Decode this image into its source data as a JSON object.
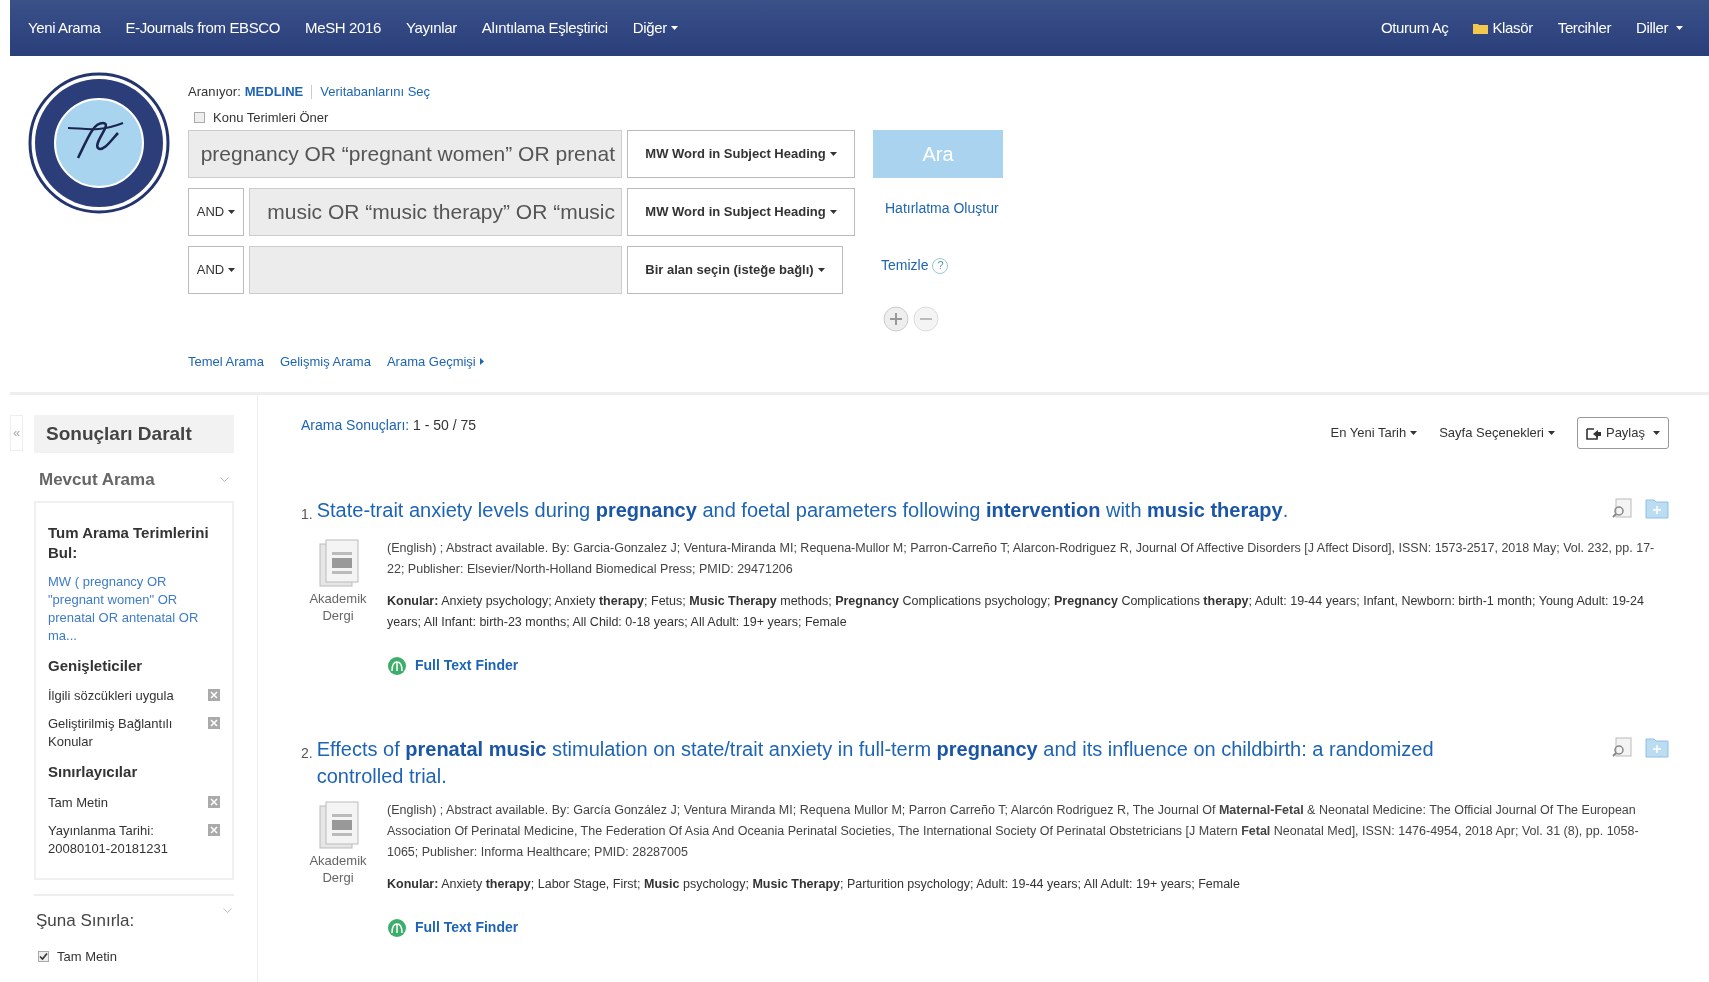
{
  "nav": {
    "left": [
      {
        "label": "Yeni Arama",
        "dropdown": false
      },
      {
        "label": "E-Journals from EBSCO",
        "dropdown": false
      },
      {
        "label": "MeSH 2016",
        "dropdown": false
      },
      {
        "label": "Yayınlar",
        "dropdown": false
      },
      {
        "label": "Alıntılama Eşleştirici",
        "dropdown": false
      },
      {
        "label": "Diğer",
        "dropdown": true
      }
    ],
    "right": [
      {
        "label": "Oturum Aç",
        "kind": "link",
        "dropdown": false
      },
      {
        "label": "Klasör",
        "kind": "folder",
        "dropdown": false
      },
      {
        "label": "Tercihler",
        "kind": "link",
        "dropdown": false
      },
      {
        "label": "Diller",
        "kind": "link",
        "dropdown": true
      }
    ]
  },
  "search": {
    "searching_label": "Aranıyor:",
    "database": "MEDLINE",
    "choose_db": "Veritabanlarını Seç",
    "suggest": {
      "label": "Konu Terimleri Öner",
      "checked": false
    },
    "rows": [
      {
        "value": "pregnancy OR “pregnant women” OR prenat",
        "field": "MW Word in Subject Heading"
      },
      {
        "operator": "AND",
        "value": "music OR “music therapy” OR “music",
        "field": "MW Word in Subject Heading"
      },
      {
        "operator": "AND",
        "field": "Bir alan seçin (isteğe bağlı)"
      }
    ],
    "search_button": "Ara",
    "alert": "Hatırlatma Oluştur",
    "clear": "Temizle",
    "help": "?",
    "links": [
      "Temel Arama",
      "Gelişmiş Arama",
      "Arama Geçmişi"
    ]
  },
  "sidebar": {
    "collapse": "«",
    "title": "Sonuçları Daralt",
    "current_search": "Mevcut Arama",
    "find_all": "Tum Arama Terimlerini Bul:",
    "query": "MW ( pregnancy OR \"pregnant women\" OR prenatal OR antenatal OR ma...",
    "expanders_title": "Genişleticiler",
    "expanders": [
      "İlgili sözcükleri uygula",
      "Geliştirilmiş Bağlantılı Konular"
    ],
    "limiters_title": "Sınırlayıcılar",
    "limiters": [
      "Tam Metin",
      "Yayınlanma Tarihi: 20080101-20181231"
    ],
    "limit_to": "Şuna Sınırla:",
    "limit_options": [
      {
        "label": "Tam Metin",
        "checked": true
      }
    ]
  },
  "results": {
    "label": "Arama Sonuçları:",
    "count": "1 - 50 / 75",
    "sort": "En Yeni Tarih",
    "page_options": "Sayfa Seçenekleri",
    "share": "Paylaş",
    "items": [
      {
        "number": "1.",
        "title": "State-trait anxiety levels during **pregnancy** and foetal parameters following **intervention** with **music therapy**.",
        "type": "Akademik Dergi",
        "details": "(English) ; Abstract available. By: Garcia-Gonzalez J; Ventura-Miranda MI; Requena-Mullor M; Parron-Carreño T; Alarcon-Rodriguez R, Journal Of Affective Disorders [J Affect Disord], ISSN: 1573-2517, 2018 May; Vol. 232, pp. 17-22; Publisher: Elsevier/North-Holland Biomedical Press; PMID: 29471206",
        "subjects": "**Konular:** Anxiety psychology; Anxiety **therapy**; Fetus; **Music Therapy** methods; **Pregnancy** Complications psychology; **Pregnancy** Complications **therapy**; Adult: 19-44 years; Infant, Newborn: birth-1 month; Young Adult: 19-24 years; All Infant: birth-23 months; All Child: 0-18 years; All Adult: 19+ years; Female",
        "fulltext": "Full Text Finder"
      },
      {
        "number": "2.",
        "title": "Effects of **prenatal music** stimulation on state/trait anxiety in full-term **pregnancy** and its influence on childbirth: a randomized controlled trial.",
        "type": "Akademik Dergi",
        "details": "(English) ; Abstract available. By: García González J; Ventura Miranda MI; Requena Mullor M; Parron Carreño T; Alarcón Rodriguez R, The Journal Of **Maternal-Fetal** & Neonatal Medicine: The Official Journal Of The European Association Of Perinatal Medicine, The Federation Of Asia And Oceania Perinatal Societies, The International Society Of Perinatal Obstetricians [J Matern **Fetal** Neonatal Med], ISSN: 1476-4954, 2018 Apr; Vol. 31 (8), pp. 1058-1065; Publisher: Informa Healthcare; PMID: 28287005",
        "subjects": "**Konular:** Anxiety **therapy**; Labor Stage, First; **Music** psychology; **Music Therapy**; Parturition psychology; Adult: 19-44 years; All Adult: 19+ years; Female",
        "fulltext": "Full Text Finder"
      }
    ]
  }
}
